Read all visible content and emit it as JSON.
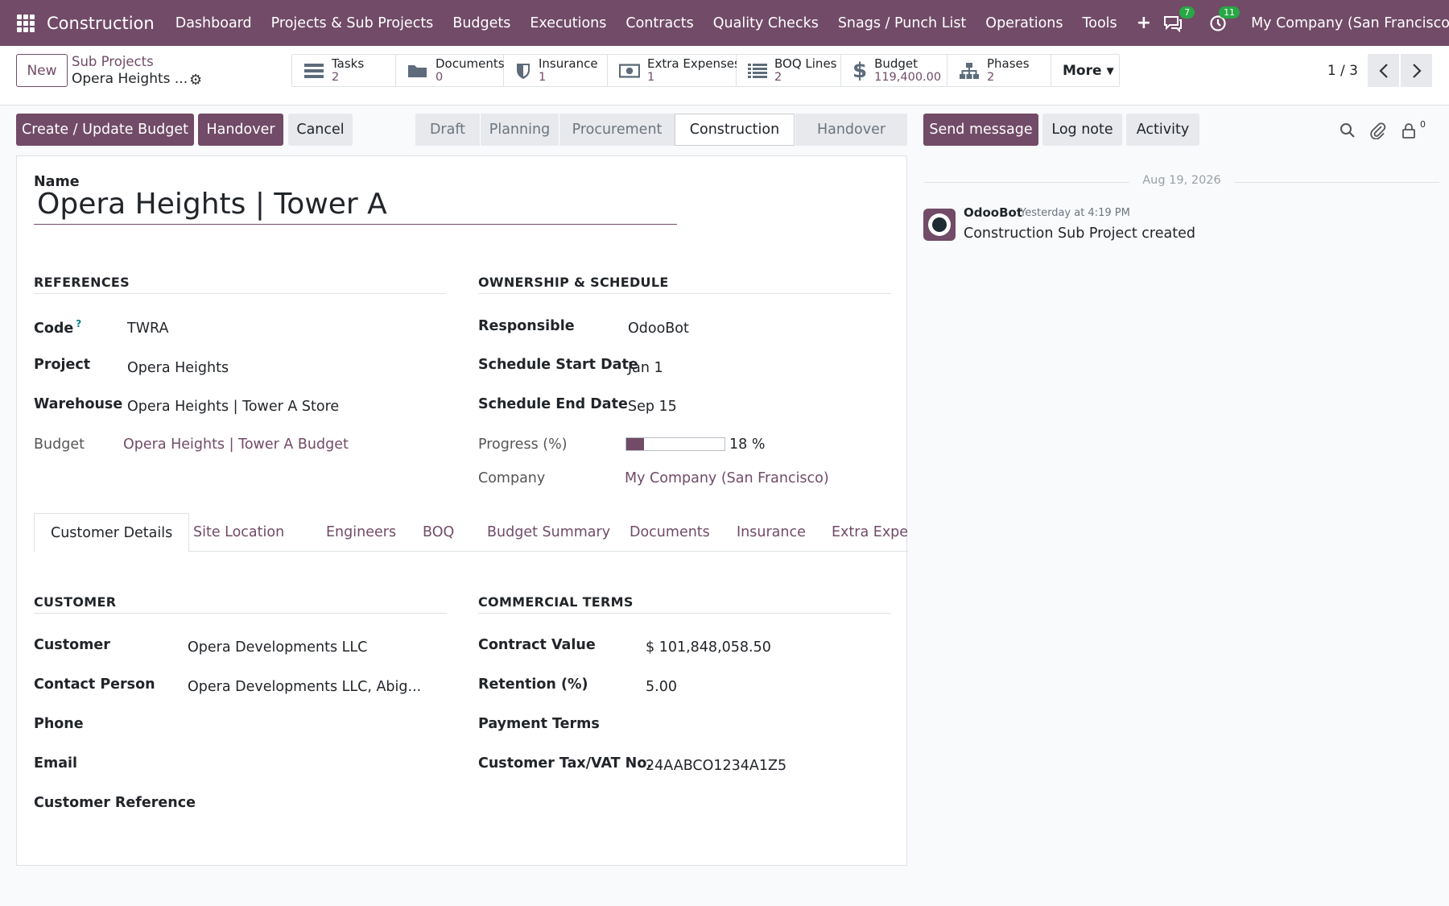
{
  "topnav": {
    "app_name": "Construction",
    "menu": [
      "Dashboard",
      "Projects & Sub Projects",
      "Budgets",
      "Executions",
      "Contracts",
      "Quality Checks",
      "Snags / Punch List",
      "Operations",
      "Tools"
    ],
    "messages_count": "7",
    "activities_count": "11",
    "company": "My Company (San Francisco)"
  },
  "control_panel": {
    "new_label": "New",
    "breadcrumb_parent": "Sub Projects",
    "breadcrumb_current": "Opera Heights ...",
    "smart_buttons": [
      {
        "label": "Tasks",
        "value": "2",
        "icon": "tasks-icon"
      },
      {
        "label": "Documents",
        "value": "0",
        "icon": "folder-icon"
      },
      {
        "label": "Insurance",
        "value": "1",
        "icon": "shield-icon"
      },
      {
        "label": "Extra Expenses",
        "value": "1",
        "icon": "money-icon"
      },
      {
        "label": "BOQ Lines",
        "value": "2",
        "icon": "list-icon"
      },
      {
        "label": "Budget",
        "value": "119,400.00",
        "icon": "dollar-icon"
      },
      {
        "label": "Phases",
        "value": "2",
        "icon": "sitemap-icon"
      }
    ],
    "more_label": "More",
    "pager": "1 / 3"
  },
  "actions": {
    "create_budget": "Create / Update Budget",
    "handover": "Handover",
    "cancel": "Cancel"
  },
  "statusbar": {
    "stages": [
      "Draft",
      "Planning",
      "Procurement",
      "Construction",
      "Handover"
    ],
    "active": "Construction"
  },
  "chatter": {
    "send_message": "Send message",
    "log_note": "Log note",
    "activity": "Activity",
    "followers_count": "0",
    "date_separator": "Aug 19, 2026",
    "message": {
      "author": "OdooBot",
      "time": "Yesterday at 4:19 PM",
      "body": "Construction Sub Project created"
    }
  },
  "form": {
    "name_label": "Name",
    "name_value": "Opera Heights | Tower A",
    "references": {
      "title": "REFERENCES",
      "code_label": "Code",
      "code_help": "?",
      "code_value": "TWRA",
      "project_label": "Project",
      "project_value": "Opera Heights",
      "warehouse_label": "Warehouse",
      "warehouse_value": "Opera Heights | Tower A Store",
      "budget_label": "Budget",
      "budget_value": "Opera Heights | Tower A Budget"
    },
    "ownership": {
      "title": "OWNERSHIP & SCHEDULE",
      "responsible_label": "Responsible",
      "responsible_value": "OdooBot",
      "start_label": "Schedule Start Date",
      "start_value": "Jan 1",
      "end_label": "Schedule End Date",
      "end_value": "Sep 15",
      "progress_label": "Progress (%)",
      "progress_value": 18,
      "progress_text": "18 %",
      "company_label": "Company",
      "company_value": "My Company (San Francisco)"
    },
    "tabs": [
      "Customer Details",
      "Site Location",
      "Engineers",
      "BOQ",
      "Budget Summary",
      "Documents",
      "Insurance",
      "Extra Expense"
    ],
    "customer": {
      "title": "CUSTOMER",
      "customer_label": "Customer",
      "customer_value": "Opera Developments LLC",
      "contact_label": "Contact Person",
      "contact_value": "Opera Developments LLC, Abig...",
      "phone_label": "Phone",
      "email_label": "Email",
      "ref_label": "Customer Reference"
    },
    "commercial": {
      "title": "COMMERCIAL TERMS",
      "contract_label": "Contract Value",
      "contract_value": "$ 101,848,058.50",
      "retention_label": "Retention (%)",
      "retention_value": "5.00",
      "payment_label": "Payment Terms",
      "tax_label": "Customer Tax/VAT No.",
      "tax_value": "24AABCO1234A1Z5"
    }
  },
  "colors": {
    "brand": "#714b67",
    "badge": "#28a745",
    "help": "#017e84"
  }
}
